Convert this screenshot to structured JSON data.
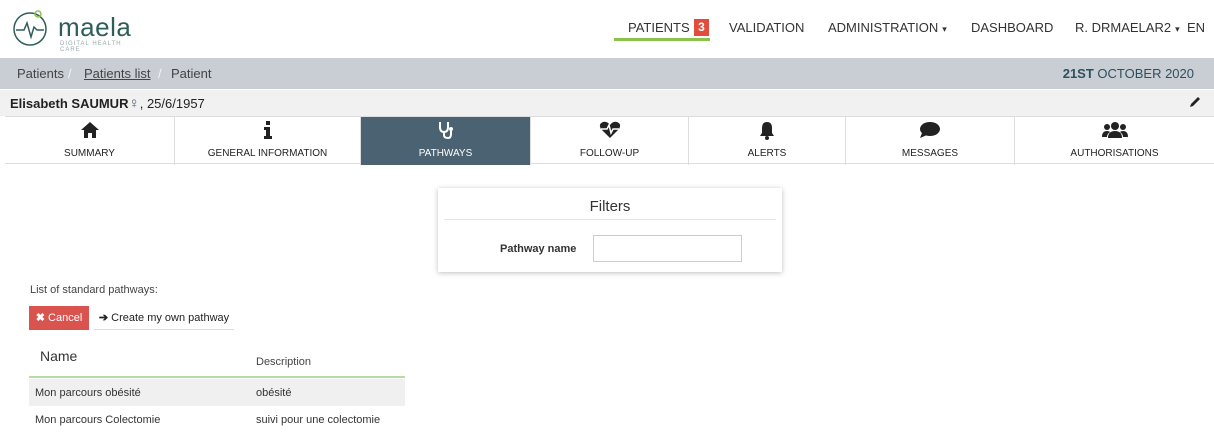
{
  "app": {
    "logo_text": "maela",
    "logo_tagline": "DIGITAL HEALTH CARE"
  },
  "nav": {
    "patients": "PATIENTS",
    "patients_badge": "3",
    "validation": "VALIDATION",
    "administration": "ADMINISTRATION",
    "dashboard": "DASHBOARD",
    "user": "R. DRMAELAR2",
    "lang": "EN",
    "caret": "▾"
  },
  "breadcrumb": {
    "items": [
      "Patients",
      "Patients list",
      "Patient"
    ],
    "separator": "/"
  },
  "date": {
    "day": "21ST",
    "rest": " OCTOBER 2020"
  },
  "patient": {
    "name": "Elisabeth SAUMUR",
    "sex_symbol": "♀",
    "birthdate": ", 25/6/1957"
  },
  "tabs": [
    {
      "label": "SUMMARY",
      "icon": "home-icon"
    },
    {
      "label": "GENERAL INFORMATION",
      "icon": "info-icon"
    },
    {
      "label": "PATHWAYS",
      "icon": "stethoscope-icon"
    },
    {
      "label": "FOLLOW-UP",
      "icon": "heartbeat-icon"
    },
    {
      "label": "ALERTS",
      "icon": "bell-icon"
    },
    {
      "label": "MESSAGES",
      "icon": "chat-icon"
    },
    {
      "label": "AUTHORISATIONS",
      "icon": "users-icon"
    }
  ],
  "filters": {
    "title": "Filters",
    "pathway_label": "Pathway name",
    "pathway_value": ""
  },
  "pathways": {
    "title": "List of standard pathways:",
    "cancel_label": "Cancel",
    "create_label": "Create my own pathway",
    "col_name": "Name",
    "col_desc": "Description",
    "rows": [
      {
        "name": "Mon parcours obésité",
        "description": "obésité"
      },
      {
        "name": "Mon parcours Colectomie",
        "description": "suivi pour une colectomie"
      }
    ]
  },
  "colors": {
    "active_tab": "#4b6272",
    "accent_green": "#8bc34a",
    "badge_red": "#e34b3c",
    "cancel_red": "#d9534f",
    "breadcrumb_bg": "#c8ced4"
  }
}
